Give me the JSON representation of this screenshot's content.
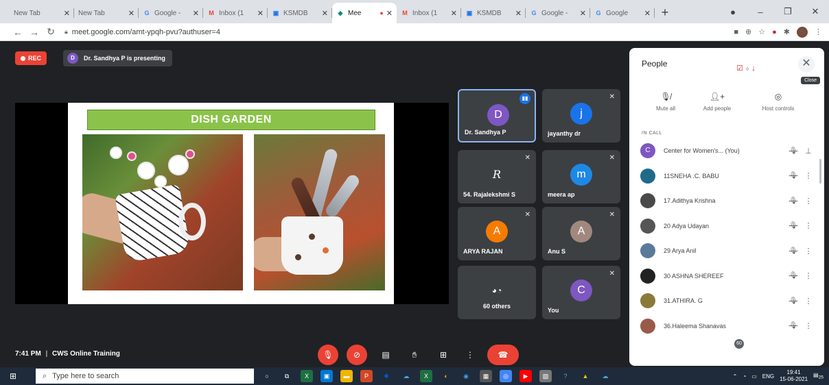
{
  "browser": {
    "tabs": [
      {
        "label": "New Tab",
        "icon": "none",
        "color": ""
      },
      {
        "label": "New Tab",
        "icon": "none",
        "color": ""
      },
      {
        "label": "Google -",
        "icon": "google-icon",
        "color": "#4285f4",
        "glyph": "G"
      },
      {
        "label": "Inbox (1",
        "icon": "gmail-icon",
        "color": "#ea4335",
        "glyph": "M"
      },
      {
        "label": "KSMDB",
        "icon": "doc-icon",
        "color": "#1a73e8",
        "glyph": "▣"
      },
      {
        "label": "Mee",
        "icon": "meet-icon",
        "color": "#00897b",
        "glyph": "◆"
      },
      {
        "label": "Inbox (1",
        "icon": "gmail-icon",
        "color": "#ea4335",
        "glyph": "M"
      },
      {
        "label": "KSMDB",
        "icon": "doc-icon",
        "color": "#1a73e8",
        "glyph": "▣"
      },
      {
        "label": "Google -",
        "icon": "google-icon",
        "color": "#4285f4",
        "glyph": "G"
      },
      {
        "label": "Google",
        "icon": "google-icon",
        "color": "#4285f4",
        "glyph": "G"
      }
    ],
    "active_tab_index": 5,
    "url": "meet.google.com/amt-ypqh-pvu?authuser=4",
    "profile_initial": "S"
  },
  "meeting": {
    "rec_label": "REC",
    "presenter_initial": "D",
    "presenting_text": "Dr. Sandhya P is presenting",
    "time": "7:41 PM",
    "separator": "|",
    "meeting_name": "CWS Online Training"
  },
  "slide": {
    "title": "DISH GARDEN"
  },
  "tiles": [
    {
      "name": "Dr. Sandhya P",
      "initial": "D",
      "color": "#7e57c2",
      "speaking": true
    },
    {
      "name": "jayanthy dr",
      "initial": "j",
      "color": "#1a73e8",
      "speaking": false
    },
    {
      "name": "54. Rajalekshmi S",
      "initial": "R",
      "color": "#3c4043",
      "speaking": false
    },
    {
      "name": "meera ap",
      "initial": "m",
      "color": "#1e88e5",
      "speaking": false
    },
    {
      "name": "ARYA RAJAN",
      "initial": "A",
      "color": "#f57c00",
      "speaking": false
    },
    {
      "name": "Anu S",
      "initial": "A",
      "color": "#a1887f",
      "speaking": false
    },
    {
      "name": "60 others",
      "initial": "",
      "color": "",
      "speaking": false
    },
    {
      "name": "You",
      "initial": "C",
      "color": "#7e57c2",
      "speaking": false
    }
  ],
  "people_panel": {
    "title": "People",
    "close_tooltip": "Close",
    "notify_count": "0",
    "actions": [
      {
        "label": "Mute all",
        "icon": "mute-all-icon"
      },
      {
        "label": "Add people",
        "icon": "add-people-icon"
      },
      {
        "label": "Host controls",
        "icon": "host-controls-icon"
      }
    ],
    "section_label": "IN CALL",
    "participants": [
      {
        "name": "Center for Women's... (You)",
        "initial": "C",
        "color": "#7e57c2"
      },
      {
        "name": "11SNEHA .C. BABU",
        "initial": "",
        "color": "#1e6a8a"
      },
      {
        "name": "17.Adithya Krishna",
        "initial": "",
        "color": "#4a4a4a"
      },
      {
        "name": "20 Adya Udayan",
        "initial": "",
        "color": "#555555"
      },
      {
        "name": "29 Arya Anil",
        "initial": "",
        "color": "#5a7a9a"
      },
      {
        "name": "30 ASHNA SHEREEF",
        "initial": "",
        "color": "#222222"
      },
      {
        "name": "31.ATHIRA. G",
        "initial": "",
        "color": "#8a7a3a"
      },
      {
        "name": "36.Haleema Shanavas",
        "initial": "",
        "color": "#9a5a4a"
      }
    ]
  },
  "controls": {
    "participants_badge": "60"
  },
  "taskbar": {
    "search_placeholder": "Type here to search",
    "language": "ENG",
    "time": "19:41",
    "date": "15-06-2021",
    "notifications": "25"
  }
}
